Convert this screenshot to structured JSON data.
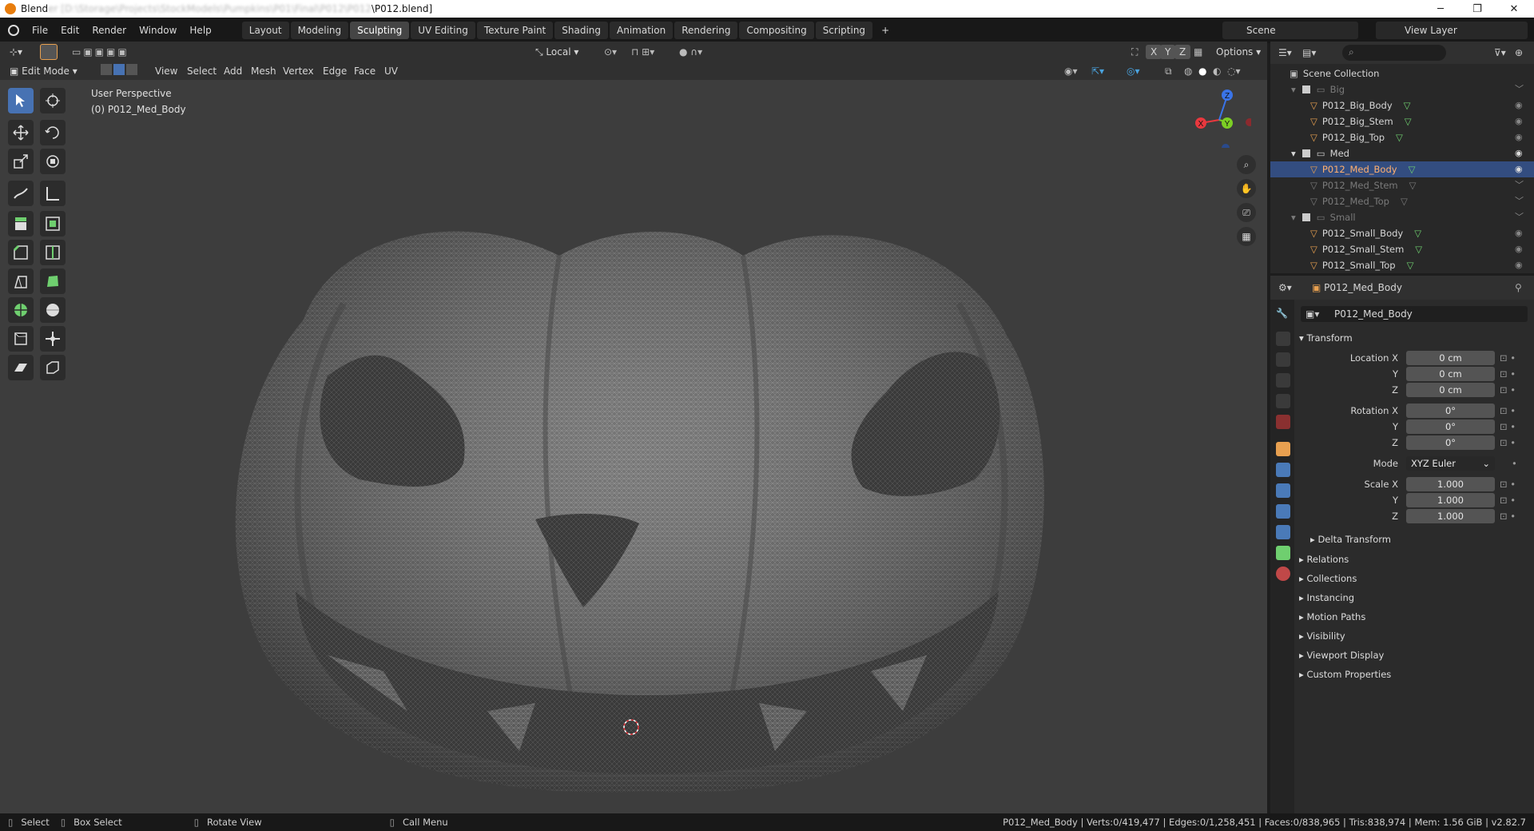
{
  "window": {
    "title_prefix": "Blend",
    "title_blurred": "er [D:\\Storage\\Projects\\StockModels\\Pumpkins\\P01\\Final\\P012\\P012",
    "title_suffix": "\\P012.blend]",
    "minimize": "─",
    "maximize": "❐",
    "close": "✕"
  },
  "menu": {
    "items": [
      "File",
      "Edit",
      "Render",
      "Window",
      "Help"
    ],
    "workspaces": [
      "Layout",
      "Modeling",
      "Sculpting",
      "UV Editing",
      "Texture Paint",
      "Shading",
      "Animation",
      "Rendering",
      "Compositing",
      "Scripting"
    ],
    "active_workspace": "Sculpting",
    "add_workspace": "+",
    "scene_label": "Scene",
    "view_layer_label": "View Layer"
  },
  "viewport_header": {
    "mode": "Edit Mode",
    "menus": [
      "View",
      "Select",
      "Add",
      "Mesh",
      "Vertex",
      "Edge",
      "Face",
      "UV"
    ],
    "transform_orientation": "Local",
    "axes": [
      "X",
      "Y",
      "Z"
    ],
    "options": "Options"
  },
  "viewport": {
    "perspective": "User Perspective",
    "object_info": "(0) P012_Med_Body",
    "gizmo_axes": [
      "X",
      "Y",
      "Z"
    ]
  },
  "outliner": {
    "root": "Scene Collection",
    "collections": [
      {
        "name": "Big",
        "children": [
          "P012_Big_Body",
          "P012_Big_Stem",
          "P012_Big_Top"
        ]
      },
      {
        "name": "Med",
        "children": [
          "P012_Med_Body",
          "P012_Med_Stem",
          "P012_Med_Top"
        ]
      },
      {
        "name": "Small",
        "children": [
          "P012_Small_Body",
          "P012_Small_Stem",
          "P012_Small_Top"
        ]
      }
    ],
    "selected": "P012_Med_Body"
  },
  "properties": {
    "object_name": "P012_Med_Body",
    "object_field": "P012_Med_Body",
    "transform_title": "Transform",
    "location_label": "Location X",
    "location": [
      "0 cm",
      "0 cm",
      "0 cm"
    ],
    "rotation_label": "Rotation X",
    "rotation": [
      "0°",
      "0°",
      "0°"
    ],
    "mode_label": "Mode",
    "mode_value": "XYZ Euler",
    "scale_label": "Scale X",
    "scale": [
      "1.000",
      "1.000",
      "1.000"
    ],
    "axis_y": "Y",
    "axis_z": "Z",
    "delta_transform": "Delta Transform",
    "panels": [
      "Relations",
      "Collections",
      "Instancing",
      "Motion Paths",
      "Visibility",
      "Viewport Display",
      "Custom Properties"
    ]
  },
  "status": {
    "select": "Select",
    "box_select": "Box Select",
    "rotate_view": "Rotate View",
    "call_menu": "Call Menu",
    "stats": "P012_Med_Body | Verts:0/419,477 | Edges:0/1,258,451 | Faces:0/838,965 | Tris:838,974 | Mem: 1.56 GiB | v2.82.7"
  },
  "colors": {
    "selection": "#334d80",
    "active_tool": "#4772b3",
    "x_axis": "#e8383e",
    "y_axis": "#7ccf24",
    "z_axis": "#3a74e8",
    "mesh_icon": "#e8a050",
    "vertex_green": "#6fcf6f"
  }
}
